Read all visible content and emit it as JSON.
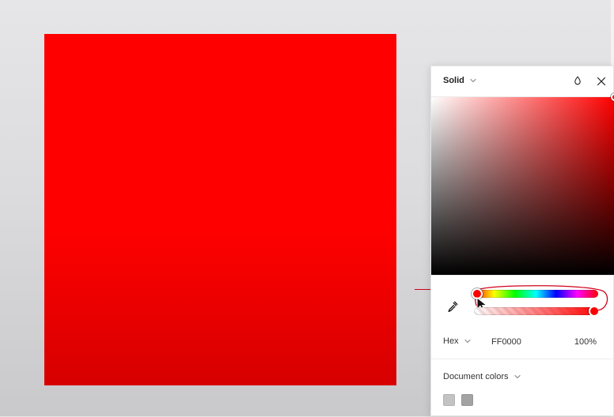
{
  "panel": {
    "fill_type_label": "Solid",
    "hex_mode_label": "Hex",
    "hex_value": "FF0000",
    "opacity_value": "100%",
    "document_colors_label": "Document colors",
    "document_colors": [
      "#c3c3c3",
      "#a3a3a3"
    ]
  },
  "icons": {
    "opacity_toggle": "droplet-icon",
    "close": "close-icon",
    "eyedropper": "eyedropper-icon"
  },
  "colors": {
    "canvas_fill": "#ff0000",
    "selected_color": "#ff0000",
    "annotation": "#d0021b"
  }
}
